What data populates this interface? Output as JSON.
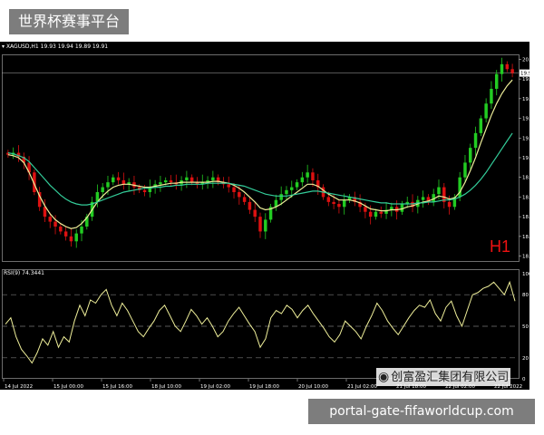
{
  "overlay": {
    "site_title": "世界杯赛事平台",
    "site_url": "portal-gate-fifaworldcup.com",
    "watermark_text": "创富盈汇集团有限公司",
    "watermark_icon": "weibo-icon"
  },
  "chart_header": {
    "symbol_line": "XAGUSD,H1  19.93 19.94 19.89 19.91",
    "timeframe_label": "H1",
    "rsi_label": "RSI(9) 74.3441"
  },
  "colors": {
    "background": "#000000",
    "bull_candle": "#22cc22",
    "bear_candle": "#dd1111",
    "ma_fast": "#eeee99",
    "ma_slow": "#33cc99",
    "rsi_line": "#eeee99",
    "grid": "#777777"
  },
  "chart_data": [
    {
      "type": "candlestick",
      "title": "XAGUSD,H1",
      "price_axis_ticks": [
        "20.05",
        "19.85",
        "19.65",
        "19.45",
        "19.25",
        "19.05",
        "18.85",
        "18.65",
        "18.45",
        "18.25",
        "18.05"
      ],
      "current_price_label": "19.91",
      "ylim": [
        18.0,
        20.1
      ],
      "x_tick_labels": [
        "14 Jul 2022",
        "15 Jul 00:00",
        "15 Jul 16:00",
        "18 Jul 10:00",
        "19 Jul 02:00",
        "19 Jul 18:00",
        "20 Jul 10:00",
        "21 Jul 02:00",
        "21 Jul 18:00",
        "22 Jul 02:00",
        "22 Jul 2022"
      ],
      "close_series": [
        19.08,
        19.1,
        19.06,
        19.0,
        18.9,
        18.7,
        18.55,
        18.45,
        18.4,
        18.35,
        18.3,
        18.25,
        18.2,
        18.28,
        18.35,
        18.45,
        18.6,
        18.7,
        18.75,
        18.8,
        18.85,
        18.82,
        18.78,
        18.8,
        18.75,
        18.72,
        18.7,
        18.75,
        18.78,
        18.8,
        18.82,
        18.8,
        18.78,
        18.82,
        18.85,
        18.8,
        18.78,
        18.8,
        18.82,
        18.85,
        18.8,
        18.78,
        18.75,
        18.7,
        18.65,
        18.6,
        18.52,
        18.45,
        18.3,
        18.42,
        18.55,
        18.62,
        18.68,
        18.72,
        18.75,
        18.8,
        18.85,
        18.9,
        18.82,
        18.75,
        18.65,
        18.6,
        18.58,
        18.55,
        18.62,
        18.65,
        18.6,
        18.55,
        18.5,
        18.45,
        18.5,
        18.48,
        18.52,
        18.55,
        18.5,
        18.58,
        18.6,
        18.55,
        18.62,
        18.65,
        18.6,
        18.68,
        18.75,
        18.6,
        18.55,
        18.65,
        18.85,
        19.0,
        19.15,
        19.3,
        19.45,
        19.6,
        19.75,
        19.9,
        20.0,
        19.95,
        19.91
      ],
      "series": [
        {
          "name": "MA fast",
          "color": "#eeee99",
          "values": [
            19.08,
            19.07,
            19.05,
            19.0,
            18.9,
            18.78,
            18.66,
            18.56,
            18.48,
            18.42,
            18.38,
            18.35,
            18.33,
            18.34,
            18.38,
            18.44,
            18.52,
            18.6,
            18.66,
            18.71,
            18.75,
            18.77,
            18.78,
            18.78,
            18.77,
            18.76,
            18.75,
            18.75,
            18.76,
            18.77,
            18.78,
            18.79,
            18.79,
            18.8,
            18.8,
            18.8,
            18.8,
            18.8,
            18.8,
            18.81,
            18.81,
            18.8,
            18.79,
            18.77,
            18.74,
            18.7,
            18.65,
            18.6,
            18.54,
            18.52,
            18.53,
            18.55,
            18.58,
            18.62,
            18.66,
            18.7,
            18.74,
            18.78,
            18.78,
            18.76,
            18.72,
            18.68,
            18.65,
            18.62,
            18.62,
            18.62,
            18.61,
            18.59,
            18.56,
            18.53,
            18.52,
            18.51,
            18.51,
            18.52,
            18.52,
            18.53,
            18.55,
            18.56,
            18.58,
            18.6,
            18.61,
            18.63,
            18.66,
            18.65,
            18.63,
            18.64,
            18.7,
            18.8,
            18.92,
            19.05,
            19.2,
            19.34,
            19.48,
            19.6,
            19.7,
            19.78,
            19.84
          ]
        },
        {
          "name": "MA slow",
          "color": "#33cc99",
          "values": [
            19.1,
            19.09,
            19.07,
            19.05,
            19.01,
            18.95,
            18.89,
            18.83,
            18.77,
            18.72,
            18.67,
            18.63,
            18.6,
            18.58,
            18.57,
            18.57,
            18.58,
            18.6,
            18.62,
            18.64,
            18.66,
            18.68,
            18.7,
            18.71,
            18.72,
            18.73,
            18.74,
            18.74,
            18.75,
            18.75,
            18.76,
            18.76,
            18.77,
            18.77,
            18.78,
            18.78,
            18.78,
            18.78,
            18.79,
            18.79,
            18.79,
            18.79,
            18.79,
            18.78,
            18.77,
            18.76,
            18.74,
            18.72,
            18.7,
            18.68,
            18.67,
            18.66,
            18.66,
            18.66,
            18.67,
            18.68,
            18.69,
            18.7,
            18.71,
            18.71,
            18.7,
            18.69,
            18.68,
            18.67,
            18.66,
            18.65,
            18.64,
            18.63,
            18.62,
            18.61,
            18.6,
            18.59,
            18.59,
            18.58,
            18.58,
            18.58,
            18.58,
            18.58,
            18.59,
            18.59,
            18.6,
            18.6,
            18.61,
            18.62,
            18.62,
            18.63,
            18.65,
            18.68,
            18.72,
            18.77,
            18.83,
            18.9,
            18.98,
            19.06,
            19.14,
            19.22,
            19.3
          ]
        }
      ]
    },
    {
      "type": "line",
      "title": "RSI(9) 74.3441",
      "ylim": [
        0,
        100
      ],
      "y_ticks": [
        "100",
        "80",
        "50",
        "20",
        "0"
      ],
      "levels": [
        80,
        50,
        20
      ],
      "series": [
        {
          "name": "RSI",
          "color": "#eeee99",
          "values": [
            52,
            58,
            40,
            28,
            22,
            15,
            25,
            38,
            32,
            45,
            30,
            40,
            35,
            55,
            70,
            60,
            75,
            72,
            80,
            85,
            70,
            60,
            72,
            65,
            55,
            45,
            40,
            48,
            55,
            65,
            70,
            60,
            50,
            45,
            55,
            66,
            60,
            52,
            58,
            50,
            40,
            45,
            55,
            62,
            68,
            60,
            52,
            45,
            30,
            38,
            58,
            65,
            62,
            70,
            66,
            58,
            65,
            70,
            62,
            55,
            48,
            40,
            35,
            42,
            55,
            50,
            45,
            38,
            50,
            60,
            72,
            65,
            55,
            48,
            42,
            50,
            58,
            65,
            70,
            68,
            75,
            62,
            55,
            68,
            74,
            60,
            50,
            65,
            80,
            82,
            86,
            88,
            92,
            86,
            80,
            92,
            74
          ]
        }
      ]
    }
  ]
}
